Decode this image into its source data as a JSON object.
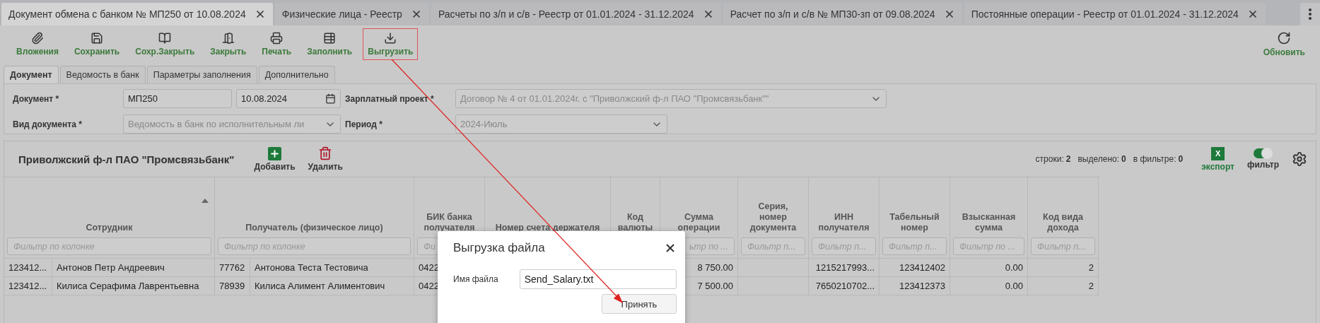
{
  "tabs": [
    {
      "label": "Документ обмена с банком № МП250 от 10.08.2024",
      "selected": true
    },
    {
      "label": "Физические лица - Реестр",
      "selected": false
    },
    {
      "label": "Расчеты по з/п и с/в - Реестр от 01.01.2024 - 31.12.2024",
      "selected": false
    },
    {
      "label": "Расчет по з/п и с/в № МП30-зп от 09.08.2024",
      "selected": false
    },
    {
      "label": "Постоянные операции - Реестр от 01.01.2024 - 31.12.2024",
      "selected": false
    }
  ],
  "toolbar": {
    "buttons": [
      {
        "label": "Вложения",
        "kind": "attach",
        "highlighted": false
      },
      {
        "label": "Сохранить",
        "kind": "save",
        "highlighted": false
      },
      {
        "label": "Сохр.Закрыть",
        "kind": "saveclose",
        "highlighted": false
      },
      {
        "label": "Закрыть",
        "kind": "close",
        "highlighted": false
      },
      {
        "label": "Печать",
        "kind": "print",
        "highlighted": false
      },
      {
        "label": "Заполнить",
        "kind": "fill",
        "highlighted": false
      },
      {
        "label": "Выгрузить",
        "kind": "export",
        "highlighted": true
      }
    ],
    "refresh": {
      "label": "Обновить"
    }
  },
  "form_tabs": [
    {
      "label": "Документ",
      "selected": true
    },
    {
      "label": "Ведомость в банк",
      "selected": false
    },
    {
      "label": "Параметры заполнения",
      "selected": false
    },
    {
      "label": "Дополнительно",
      "selected": false
    }
  ],
  "form": {
    "document": {
      "label": "Документ *",
      "number": "МП250",
      "date": "10.08.2024",
      "disabled": false
    },
    "salary_project": {
      "label": "Зарплатный проект *",
      "value": "Договор № 4 от 01.01.2024г. с \"Приволжский ф-л ПАО \"Промсвязьбанк\"\"",
      "disabled": true
    },
    "document_type": {
      "label": "Вид документа *",
      "value": "Ведомость в банк по исполнительным ли",
      "disabled": true
    },
    "period": {
      "label": "Период *",
      "value": "2024-Июль",
      "disabled": true
    }
  },
  "grid": {
    "title": "Приволжский ф-л ПАО \"Промсвязьбанк\"",
    "add_label": "Добавить",
    "delete_label": "Удалить",
    "stats": [
      {
        "label": "строки:",
        "value": "2"
      },
      {
        "label": "выделено:",
        "value": "0"
      },
      {
        "label": "в фильтре:",
        "value": "0"
      }
    ],
    "export": {
      "icon": "X",
      "label": "экспорт"
    },
    "filter": {
      "label": "фильтр",
      "on": true
    },
    "columns": [
      {
        "label": "Сотрудник",
        "filter_placeholder": "Фильтр по колонке",
        "sorted": true
      },
      {
        "label": "Получатель (физическое лицо)",
        "filter_placeholder": "Фильтр по колонке",
        "sorted": false
      },
      {
        "label": "БИК банка получателя",
        "filter_placeholder": "Фи",
        "sorted": false
      },
      {
        "label": "Номер счета держателя",
        "sorted": false
      },
      {
        "label": "Код валюты",
        "sorted": false
      },
      {
        "label": "Сумма операции",
        "filter_placeholder": "ьтр по ...",
        "sorted": false
      },
      {
        "label": "Серия, номер документа",
        "filter_placeholder": "Фильтр п...",
        "sorted": false
      },
      {
        "label": "ИНН получателя",
        "filter_placeholder": "Фильтр п...",
        "sorted": false
      },
      {
        "label": "Табельный номер",
        "filter_placeholder": "Фильтр п...",
        "sorted": false
      },
      {
        "label": "Взысканная сумма",
        "filter_placeholder": "Фильтр по ...",
        "sorted": false
      },
      {
        "label": "Код вида дохода",
        "filter_placeholder": "Фильтр п...",
        "sorted": false
      }
    ],
    "rows": [
      {
        "employee_code": "123412...",
        "employee": "Антонов Петр Андреевич",
        "recipient_code": "77762",
        "recipient": "Антонова Теста Тестовича",
        "bik": "0422",
        "amount": "8 750.00",
        "inn": "1215217993...",
        "tab_number": "123412402",
        "recovered": "0.00",
        "income_code": "2"
      },
      {
        "employee_code": "123412...",
        "employee": "Килиса Серафима Лаврентьевна",
        "recipient_code": "78939",
        "recipient": "Килиса Алимент Алиментович",
        "bik": "0422",
        "amount": "7 500.00",
        "inn": "7650210702...",
        "tab_number": "123412373",
        "recovered": "0.00",
        "income_code": "2"
      }
    ]
  },
  "dialog": {
    "title": "Выгрузка файла",
    "field_label": "Имя файла",
    "file_name": "Send_Salary.txt",
    "accept_label": "Принять"
  }
}
